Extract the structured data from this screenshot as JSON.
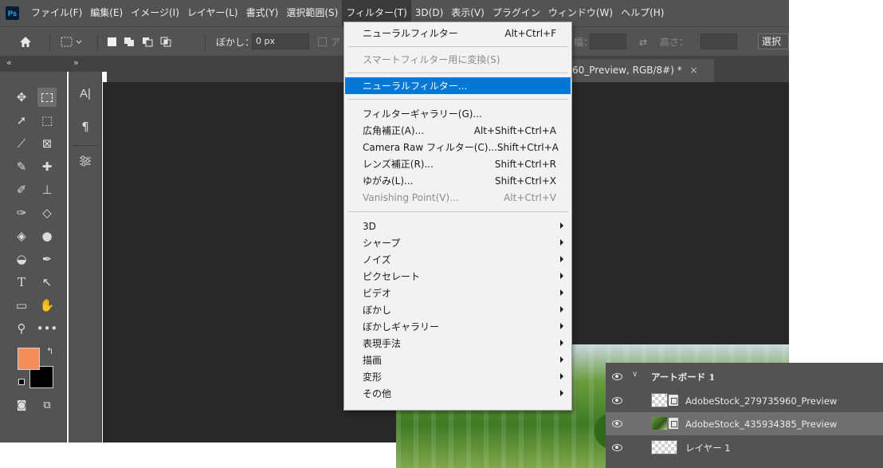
{
  "menubar": {
    "logo": "Ps",
    "items": [
      {
        "label": "ファイル(F)"
      },
      {
        "label": "編集(E)"
      },
      {
        "label": "イメージ(I)"
      },
      {
        "label": "レイヤー(L)"
      },
      {
        "label": "書式(Y)"
      },
      {
        "label": "選択範囲(S)"
      },
      {
        "label": "フィルター(T)"
      },
      {
        "label": "3D(D)"
      },
      {
        "label": "表示(V)"
      },
      {
        "label": "プラグイン"
      },
      {
        "label": "ウィンドウ(W)"
      },
      {
        "label": "ヘルプ(H)"
      }
    ]
  },
  "options_bar": {
    "home_icon": "home-icon",
    "feather_label": "ぼかし：",
    "feather_value": "0 px",
    "antialias_fragment": "ア",
    "width_fragment": "幅：",
    "height_label": "高さ：",
    "select_mask_fragment": "選択"
  },
  "document_tab": {
    "title_fragment": "60_Preview, RGB/8#) *",
    "close": "×"
  },
  "collapse_left": "«",
  "collapse_right": "»",
  "filter_menu": {
    "items": [
      {
        "label": "ニューラルフィルター",
        "shortcut": "Alt+Ctrl+F",
        "state": "normal"
      },
      {
        "label": "スマートフィルター用に変換(S)",
        "shortcut": "",
        "state": "disabled"
      },
      {
        "label": "ニューラルフィルター...",
        "shortcut": "",
        "state": "highlighted"
      },
      {
        "label": "フィルターギャラリー(G)...",
        "shortcut": "",
        "state": "normal"
      },
      {
        "label": "広角補正(A)...",
        "shortcut": "Alt+Shift+Ctrl+A",
        "state": "normal"
      },
      {
        "label": "Camera Raw フィルター(C)...",
        "shortcut": "Shift+Ctrl+A",
        "state": "normal"
      },
      {
        "label": "レンズ補正(R)...",
        "shortcut": "Shift+Ctrl+R",
        "state": "normal"
      },
      {
        "label": "ゆがみ(L)...",
        "shortcut": "Shift+Ctrl+X",
        "state": "normal"
      },
      {
        "label": "Vanishing Point(V)...",
        "shortcut": "Alt+Ctrl+V",
        "state": "disabled"
      },
      {
        "label": "3D",
        "shortcut": "",
        "state": "submenu"
      },
      {
        "label": "シャープ",
        "shortcut": "",
        "state": "submenu"
      },
      {
        "label": "ノイズ",
        "shortcut": "",
        "state": "submenu"
      },
      {
        "label": "ピクセレート",
        "shortcut": "",
        "state": "submenu"
      },
      {
        "label": "ビデオ",
        "shortcut": "",
        "state": "submenu"
      },
      {
        "label": "ぼかし",
        "shortcut": "",
        "state": "submenu"
      },
      {
        "label": "ぼかしギャラリー",
        "shortcut": "",
        "state": "submenu"
      },
      {
        "label": "表現手法",
        "shortcut": "",
        "state": "submenu"
      },
      {
        "label": "描画",
        "shortcut": "",
        "state": "submenu"
      },
      {
        "label": "変形",
        "shortcut": "",
        "state": "submenu"
      },
      {
        "label": "その他",
        "shortcut": "",
        "state": "submenu"
      }
    ]
  },
  "tools": [
    "move-icon",
    "marquee-icon",
    "lasso-icon",
    "object-select-icon",
    "crop-icon",
    "frame-icon",
    "eyedropper-icon",
    "healing-icon",
    "brush-icon",
    "stamp-icon",
    "history-brush-icon",
    "eraser-icon",
    "bucket-icon",
    "blur-drop-icon",
    "dodge-icon",
    "pen-icon",
    "type-icon",
    "path-select-icon",
    "rectangle-icon",
    "hand-icon",
    "zoom-icon",
    "more-icon"
  ],
  "colors": {
    "foreground": "#f28d5a",
    "background": "#000000",
    "highlight": "#0078d7",
    "ui_panel": "#535353",
    "workspace": "#282828"
  },
  "panel_strip": {
    "type_icon_text": "A|",
    "paragraph_icon_text": "¶"
  },
  "layers": {
    "group_name": "アートボード 1",
    "rows": [
      {
        "name": "AdobeStock_279735960_Preview",
        "selected": false
      },
      {
        "name": "AdobeStock_435934385_Preview",
        "selected": true
      },
      {
        "name": "レイヤー 1",
        "selected": false
      }
    ]
  }
}
